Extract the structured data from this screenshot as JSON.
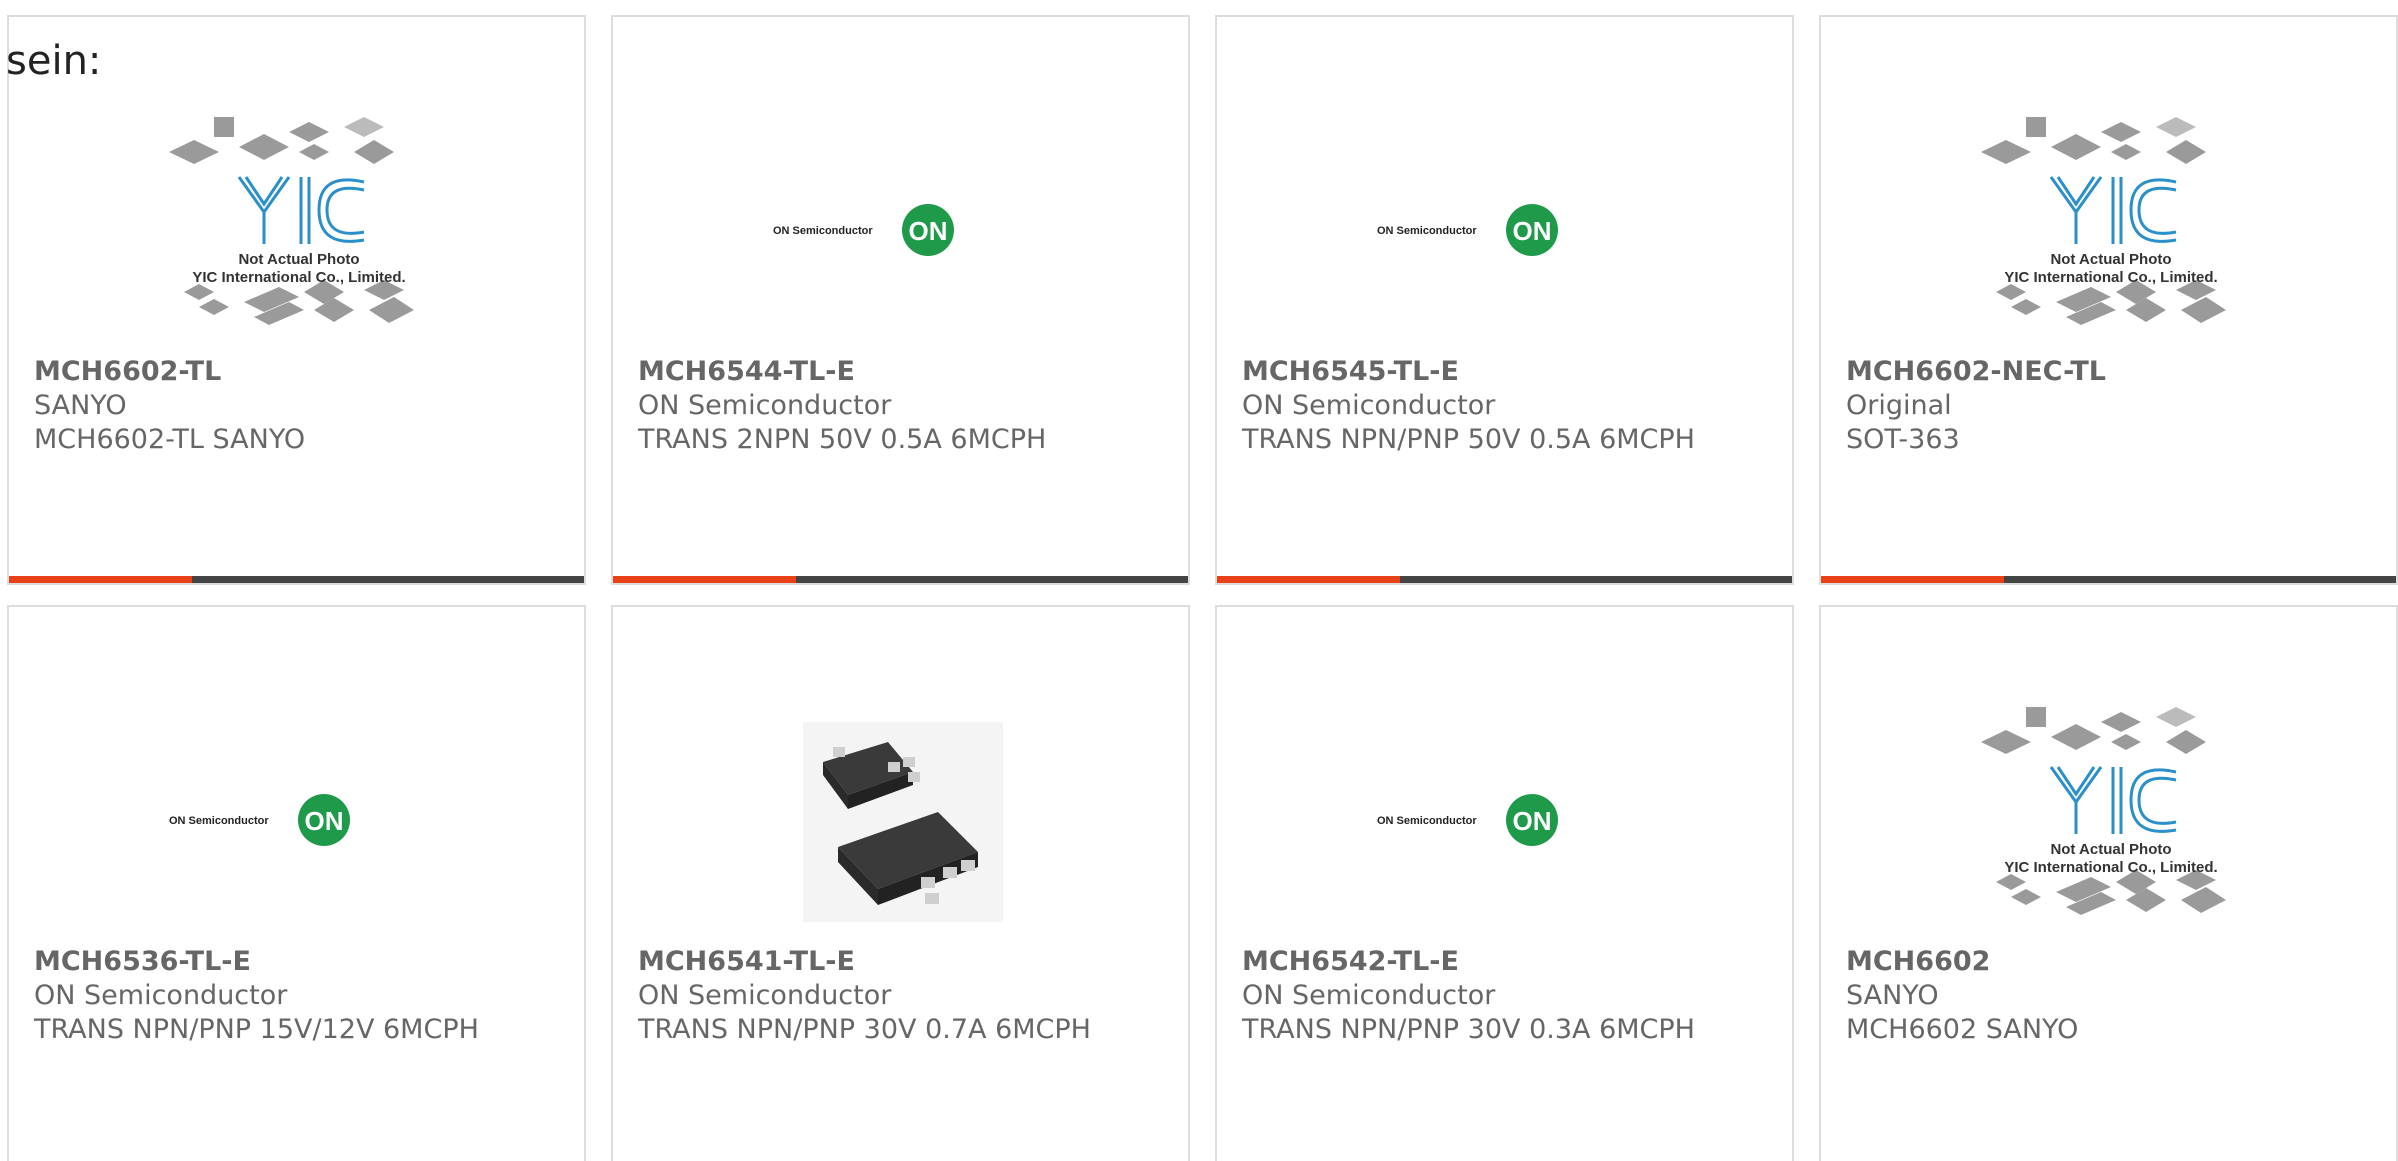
{
  "page_label": "sein:",
  "colors": {
    "accent": "#e84118",
    "bar_dark": "#444444",
    "on_green": "#1f9a4a",
    "yic_blue": "#2b8fc9"
  },
  "placeholder": {
    "line1": "Not Actual Photo",
    "line2": "YIC International Co., Limited.",
    "brand": "YIC"
  },
  "on_logo": {
    "text": "ON Semiconductor",
    "badge": "ON"
  },
  "products": [
    {
      "part": "MCH6602-TL",
      "maker": "SANYO",
      "desc": "MCH6602-TL SANYO",
      "image": "yic-placeholder"
    },
    {
      "part": "MCH6544-TL-E",
      "maker": "ON Semiconductor",
      "desc": "TRANS 2NPN 50V 0.5A 6MCPH",
      "image": "on-semiconductor-logo"
    },
    {
      "part": "MCH6545-TL-E",
      "maker": "ON Semiconductor",
      "desc": "TRANS NPN/PNP 50V 0.5A 6MCPH",
      "image": "on-semiconductor-logo"
    },
    {
      "part": "MCH6602-NEC-TL",
      "maker": "Original",
      "desc": "SOT-363",
      "image": "yic-placeholder"
    },
    {
      "part": "MCH6536-TL-E",
      "maker": "ON Semiconductor",
      "desc": "TRANS NPN/PNP 15V/12V 6MCPH",
      "image": "on-semiconductor-logo"
    },
    {
      "part": "MCH6541-TL-E",
      "maker": "ON Semiconductor",
      "desc": "TRANS NPN/PNP 30V 0.7A 6MCPH",
      "image": "chip-photo"
    },
    {
      "part": "MCH6542-TL-E",
      "maker": "ON Semiconductor",
      "desc": "TRANS NPN/PNP 30V 0.3A 6MCPH",
      "image": "on-semiconductor-logo"
    },
    {
      "part": "MCH6602",
      "maker": "SANYO",
      "desc": "MCH6602 SANYO",
      "image": "yic-placeholder"
    }
  ]
}
